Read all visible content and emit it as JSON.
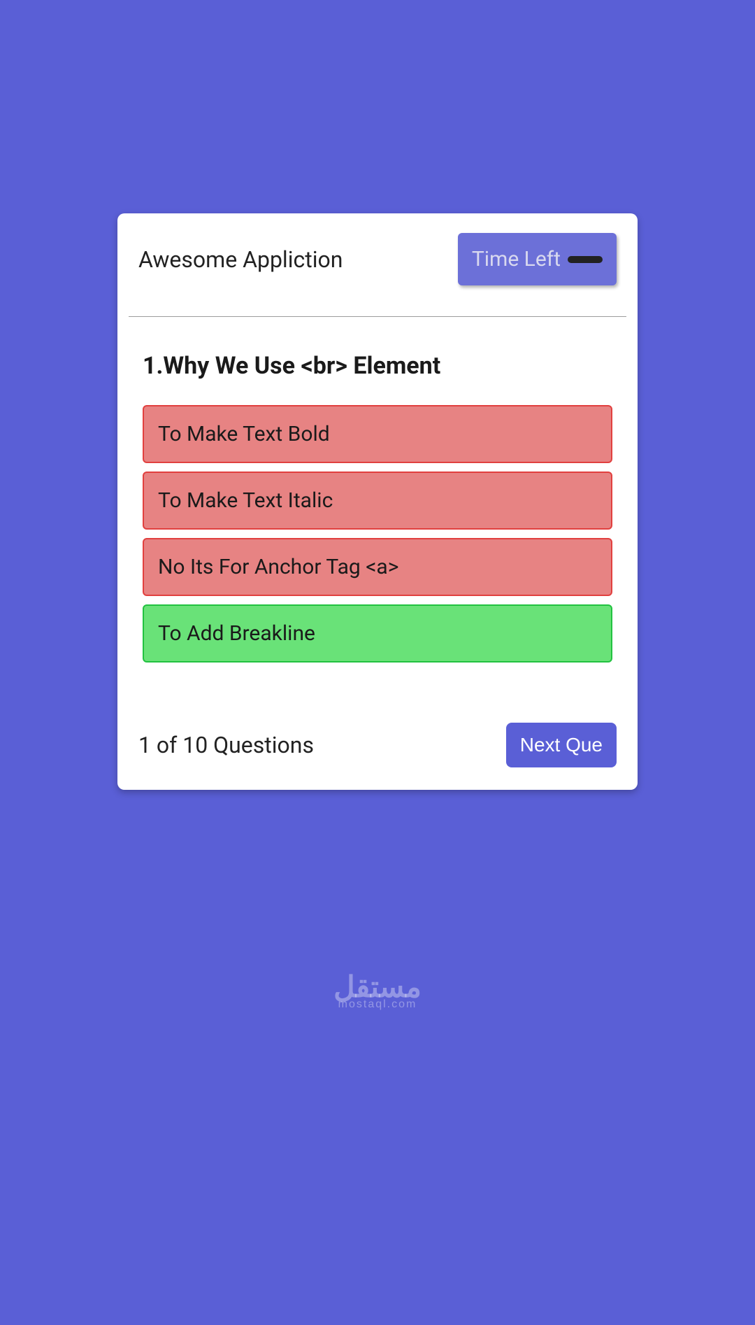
{
  "header": {
    "app_title": "Awesome Appliction",
    "time_left_label": "Time Left"
  },
  "question": {
    "number": 1,
    "text": "1.Why We Use <br> Element",
    "options": [
      {
        "label": "To Make Text Bold",
        "state": "wrong"
      },
      {
        "label": "To Make Text Italic",
        "state": "wrong"
      },
      {
        "label": "No Its For Anchor Tag <a>",
        "state": "wrong"
      },
      {
        "label": "To Add Breakline",
        "state": "correct"
      }
    ]
  },
  "footer": {
    "progress": "1 of 10 Questions",
    "next_label": "Next Que"
  },
  "watermark": {
    "ar": "مستقل",
    "en": "mostaql.com"
  }
}
